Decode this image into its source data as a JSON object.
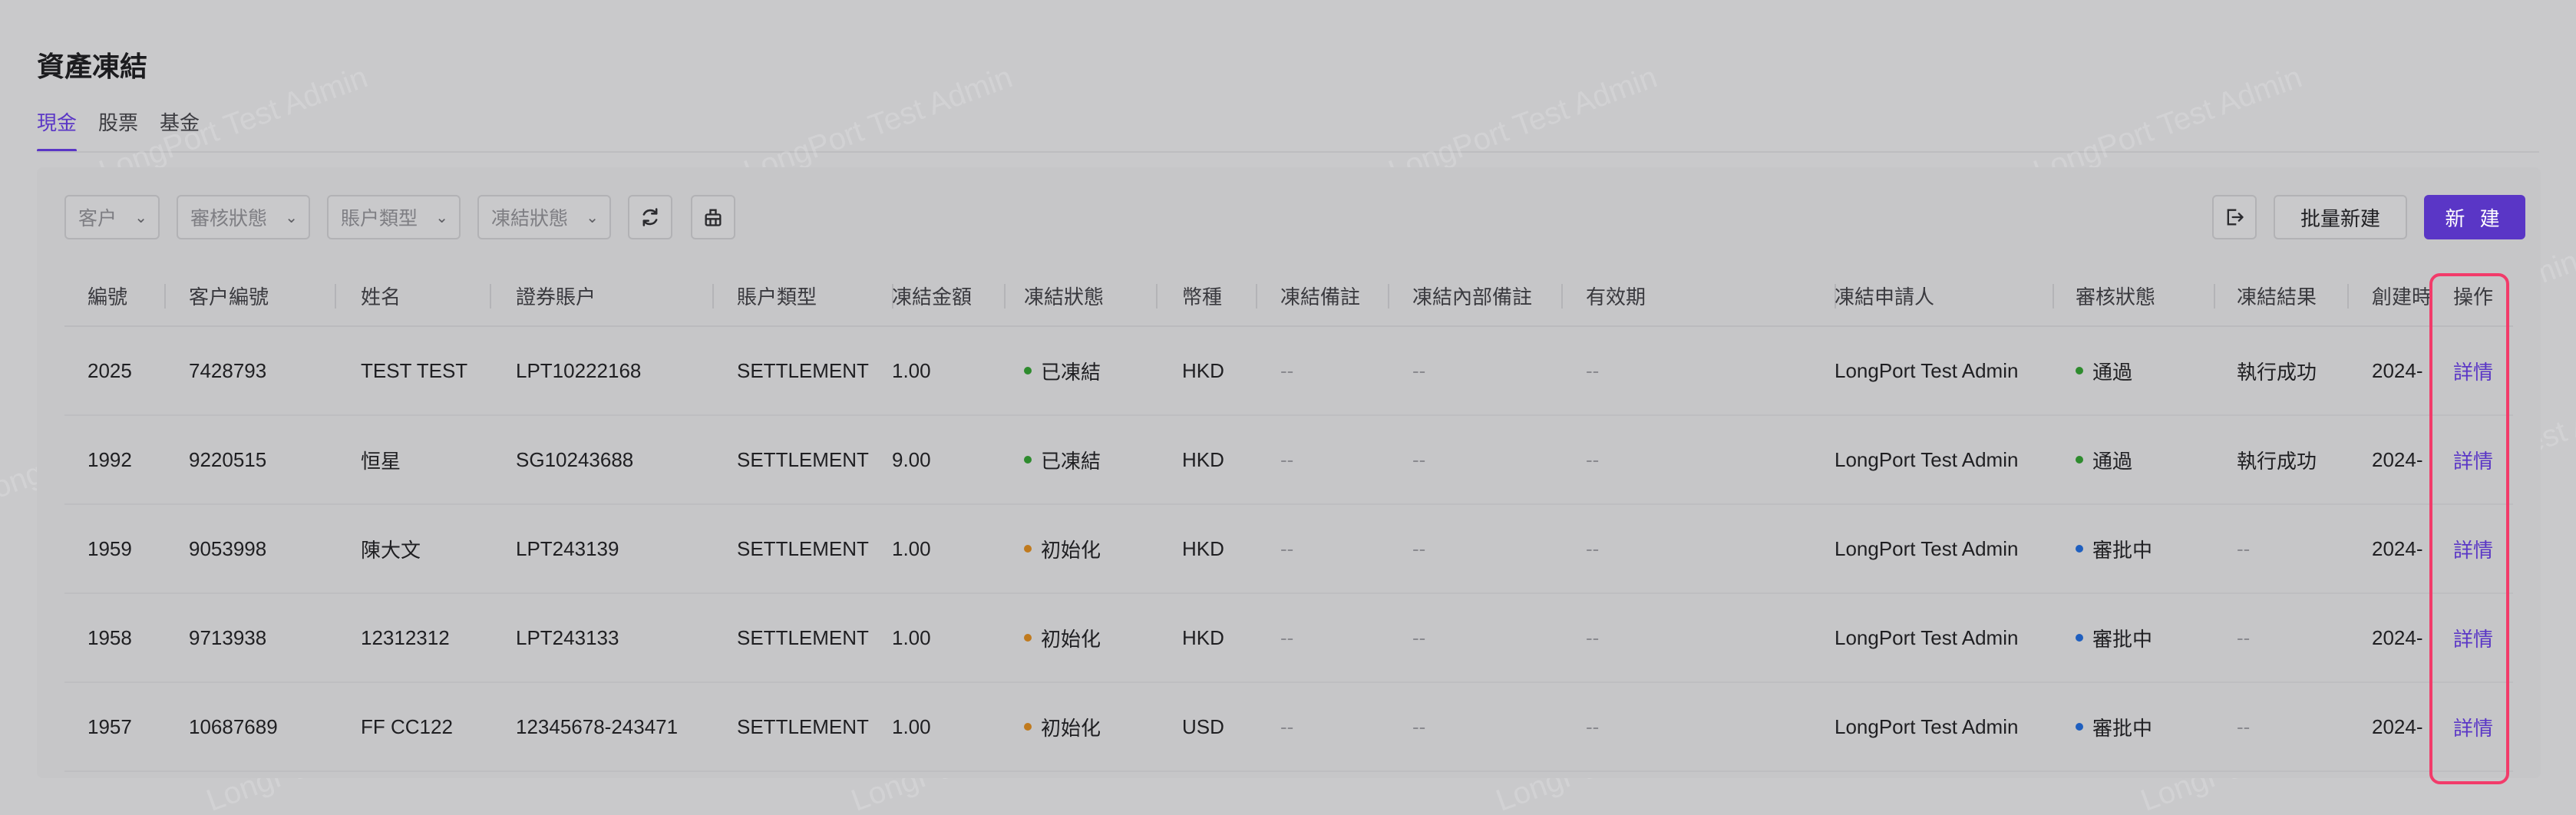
{
  "page_title": "資產凍結",
  "tabs": [
    {
      "label": "現金",
      "active": true
    },
    {
      "label": "股票",
      "active": false
    },
    {
      "label": "基金",
      "active": false
    }
  ],
  "filters": [
    {
      "placeholder": "客户"
    },
    {
      "placeholder": "審核狀態"
    },
    {
      "placeholder": "賬户類型"
    },
    {
      "placeholder": "凍結狀態"
    }
  ],
  "toolbar": {
    "refresh_icon": "refresh-icon",
    "clear_icon": "clear-icon",
    "export_icon": "export-icon",
    "batch_create_label": "批量新建",
    "create_label": "新 建"
  },
  "watermark_text": "LongPort Test Admin",
  "columns": [
    "編號",
    "客户編號",
    "姓名",
    "證券賬户",
    "賬户類型",
    "凍結金額",
    "凍結狀態",
    "幣種",
    "凍結備註",
    "凍結內部備註",
    "有效期",
    "凍結申請人",
    "審核狀態",
    "凍結結果",
    "創建時",
    "操作"
  ],
  "rows": [
    {
      "id": "2025",
      "client_id": "7428793",
      "name": "TEST TEST",
      "account": "LPT10222168",
      "account_type": "SETTLEMENT",
      "amount": "1.00",
      "freeze_status": "已凍結",
      "currency": "HKD",
      "remark": "--",
      "internal_remark": "--",
      "validity": "--",
      "applicant": "LongPort Test Admin",
      "review_status": "通過",
      "result": "執行成功",
      "created": "2024-",
      "action": "詳情"
    },
    {
      "id": "1992",
      "client_id": "9220515",
      "name": "恒星",
      "account": "SG10243688",
      "account_type": "SETTLEMENT",
      "amount": "9.00",
      "freeze_status": "已凍結",
      "currency": "HKD",
      "remark": "--",
      "internal_remark": "--",
      "validity": "--",
      "applicant": "LongPort Test Admin",
      "review_status": "通過",
      "result": "執行成功",
      "created": "2024-",
      "action": "詳情"
    },
    {
      "id": "1959",
      "client_id": "9053998",
      "name": "陳大文",
      "account": "LPT243139",
      "account_type": "SETTLEMENT",
      "amount": "1.00",
      "freeze_status": "初始化",
      "currency": "HKD",
      "remark": "--",
      "internal_remark": "--",
      "validity": "--",
      "applicant": "LongPort Test Admin",
      "review_status": "審批中",
      "result": "--",
      "created": "2024-",
      "action": "詳情"
    },
    {
      "id": "1958",
      "client_id": "9713938",
      "name": "12312312",
      "account": "LPT243133",
      "account_type": "SETTLEMENT",
      "amount": "1.00",
      "freeze_status": "初始化",
      "currency": "HKD",
      "remark": "--",
      "internal_remark": "--",
      "validity": "--",
      "applicant": "LongPort Test Admin",
      "review_status": "審批中",
      "result": "--",
      "created": "2024-",
      "action": "詳情"
    },
    {
      "id": "1957",
      "client_id": "10687689",
      "name": "FF CC122",
      "account": "12345678-243471",
      "account_type": "SETTLEMENT",
      "amount": "1.00",
      "freeze_status": "初始化",
      "currency": "USD",
      "remark": "--",
      "internal_remark": "--",
      "validity": "--",
      "applicant": "LongPort Test Admin",
      "review_status": "審批中",
      "result": "--",
      "created": "2024-",
      "action": "詳情"
    }
  ],
  "status_colors": {
    "已凍結": "#2e8b2e",
    "初始化": "#c07a1e",
    "通過": "#2e8b2e",
    "審批中": "#1f5fbf"
  },
  "colors": {
    "accent": "#5a36c6",
    "highlight": "#f23b6a"
  }
}
